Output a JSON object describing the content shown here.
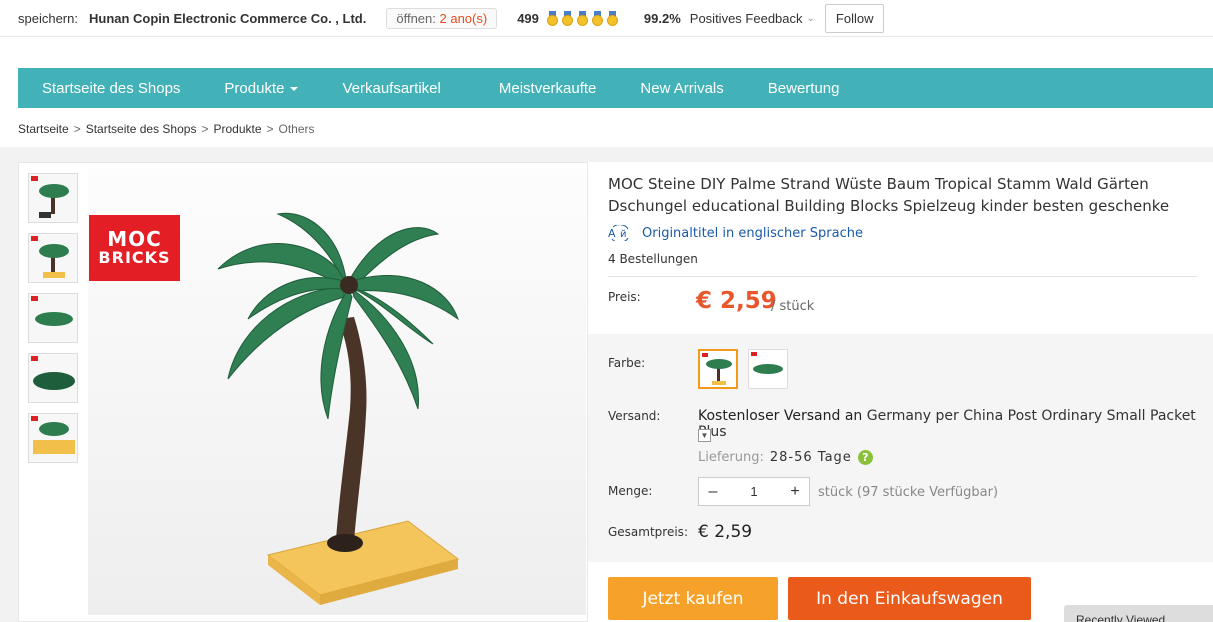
{
  "store": {
    "save_label": "speichern:",
    "name": "Hunan Copin Electronic Commerce Co. , Ltd.",
    "open_label": "öffnen: ",
    "open_years": "2 ano(s)",
    "score": "499",
    "feedback_pct": "99.2%",
    "feedback_label": "Positives Feedback",
    "follow_label": "Follow"
  },
  "nav": {
    "items": [
      {
        "label": "Startseite des Shops"
      },
      {
        "label": "Produkte"
      },
      {
        "label": "Verkaufsartikel"
      },
      {
        "label": "Meistverkaufte"
      },
      {
        "label": "New Arrivals"
      },
      {
        "label": "Bewertung"
      }
    ],
    "color": "#43b2b8"
  },
  "breadcrumb": {
    "items": [
      "Startseite",
      "Startseite des Shops",
      "Produkte",
      "Others"
    ],
    "separator": ">"
  },
  "product": {
    "logo_line1": "MOC",
    "logo_line2": "BRICKS",
    "title": "MOC Steine DIY Palme Strand Wüste Baum Tropical Stamm Wald Gärten Dschungel educational Building Blocks Spielzeug kinder besten geschenke",
    "original_title_link": "Originaltitel in englischer Sprache",
    "orders": "4 Bestellungen",
    "price_label": "Preis:",
    "price": "€ 2,59",
    "price_unit": "/ stück",
    "color_label": "Farbe:",
    "shipping_label": "Versand:",
    "shipping_free": "Kostenloser Versand an",
    "shipping_detail": " Germany per China Post Ordinary Small Packet Plus",
    "delivery_label": "Lieferung:",
    "delivery_days": "28-56 Tage",
    "quantity_label": "Menge:",
    "quantity_value": "1",
    "quantity_available": "stück (97 stücke Verfügbar)",
    "total_label": "Gesamtpreis:",
    "total_value": "€ 2,59",
    "buy_now_label": "Jetzt kaufen",
    "add_to_cart_label": "In den Einkaufswagen",
    "recently_viewed_label": "Recently Viewed",
    "accent_color": "#e9562b"
  },
  "icons": {
    "translate": "translate-icon",
    "help": "help-icon",
    "dropdown": "chevron-down-icon",
    "medal": "medal-icon"
  }
}
